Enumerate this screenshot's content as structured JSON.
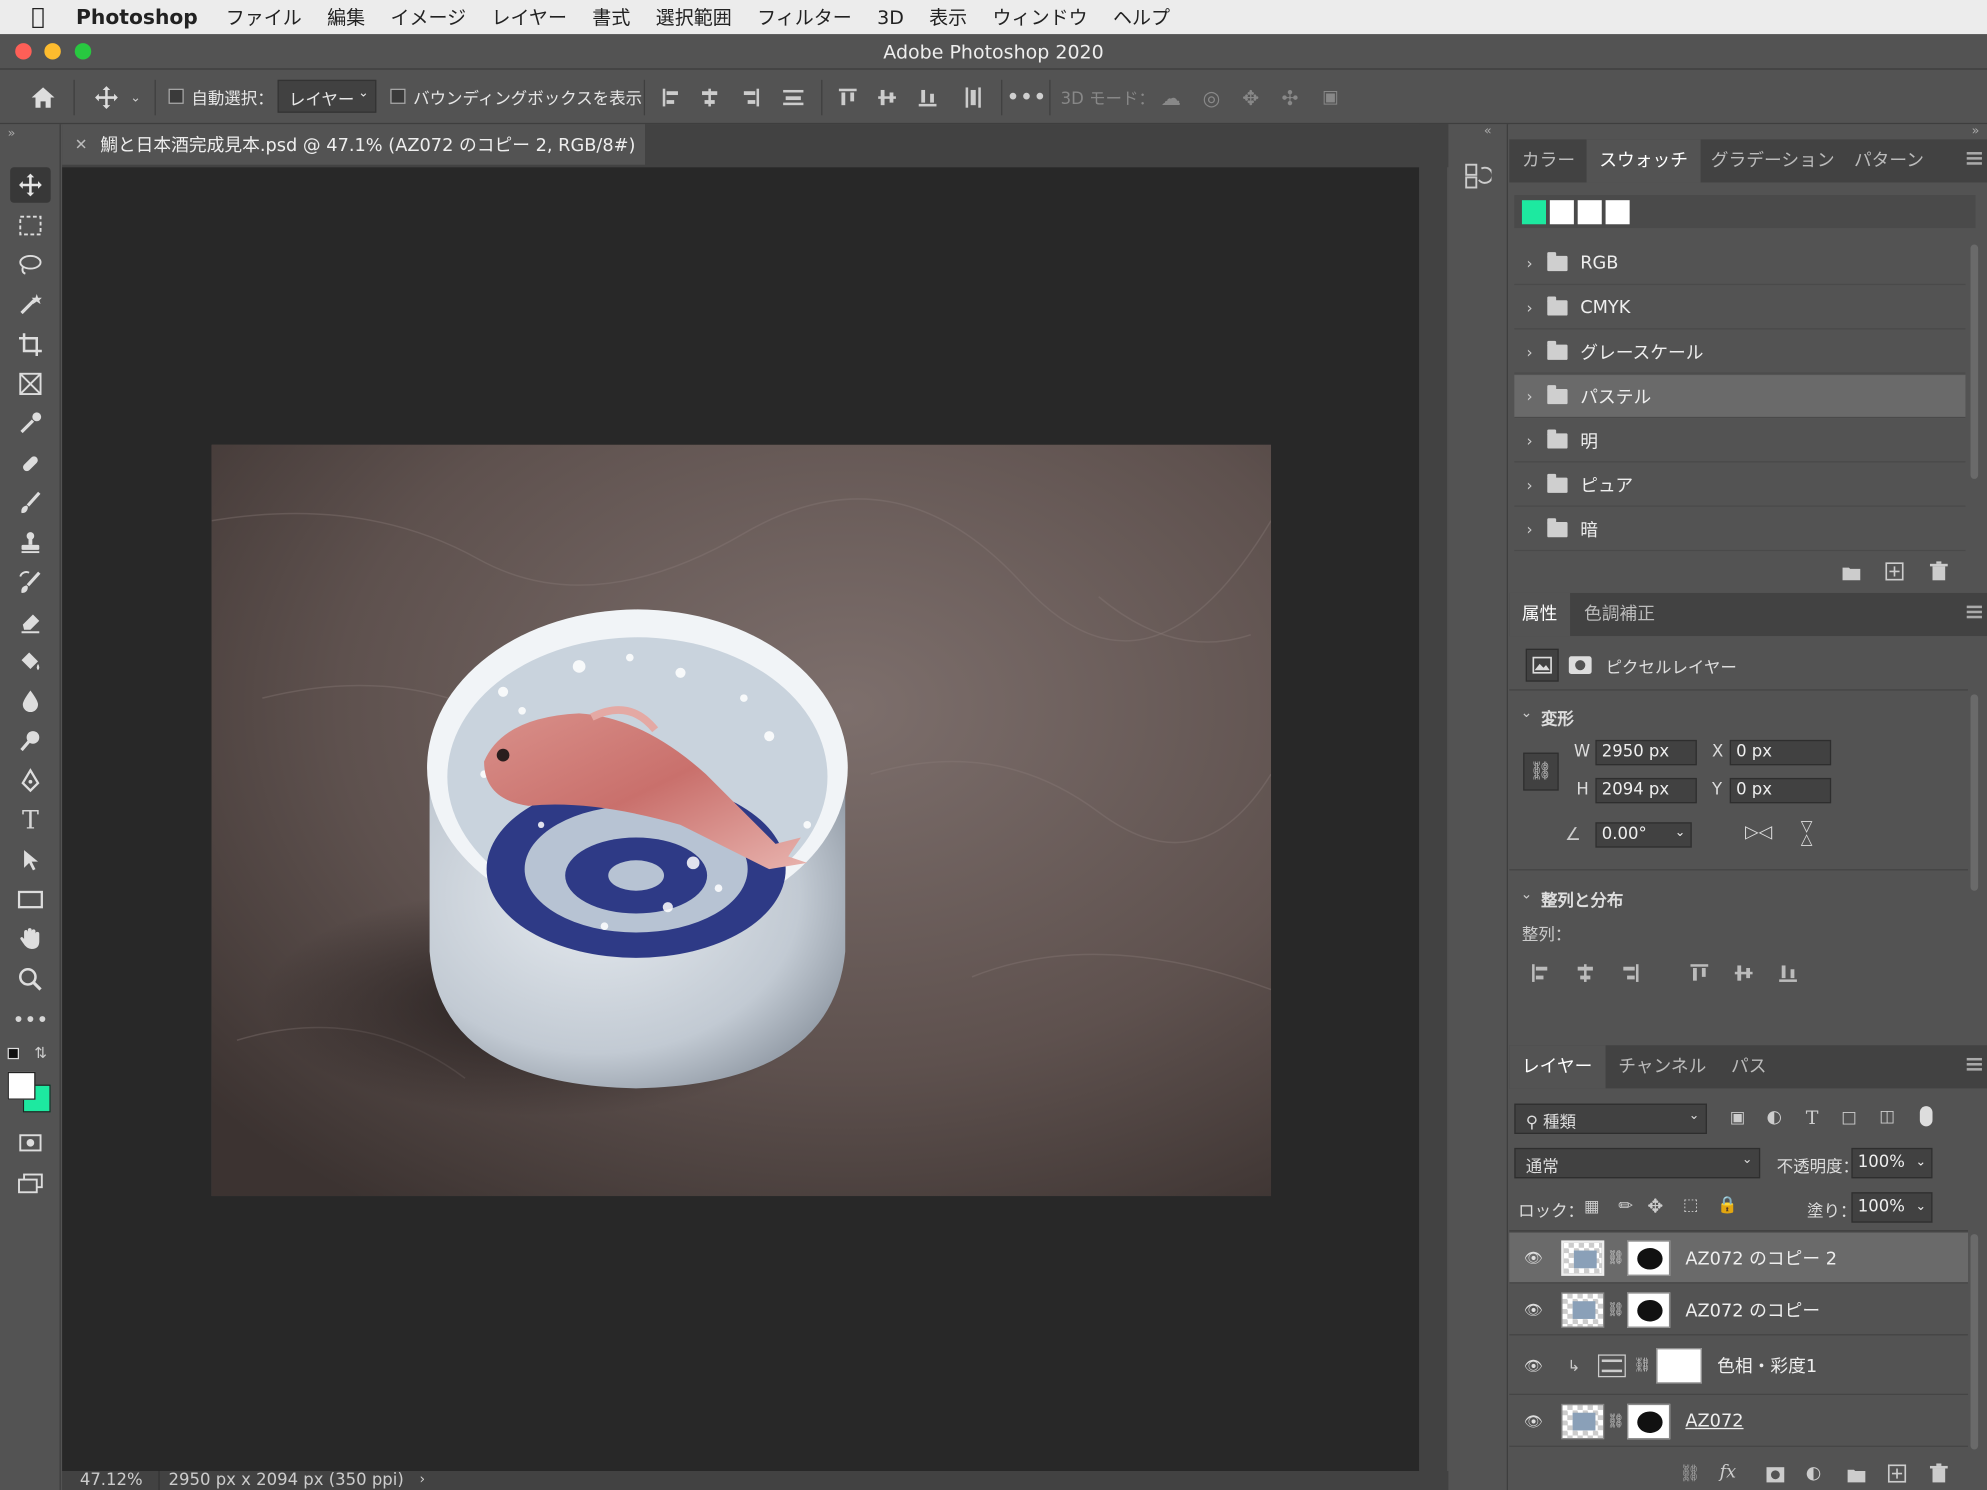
{
  "menubar": {
    "app_name": "Photoshop",
    "items": [
      "ファイル",
      "編集",
      "イメージ",
      "レイヤー",
      "書式",
      "選択範囲",
      "フィルター",
      "3D",
      "表示",
      "ウィンドウ",
      "ヘルプ"
    ]
  },
  "window": {
    "title": "Adobe Photoshop 2020"
  },
  "options": {
    "auto_select_label": "自動選択：",
    "auto_select_target": "レイヤー",
    "bounding_box_label": "バウンディングボックスを表示",
    "mode_3d_label": "3D モード："
  },
  "document": {
    "tab_title": "鯛と日本酒完成見本.psd @ 47.1% (AZ072 のコピー 2, RGB/8#)",
    "zoom_status": "47.12%",
    "size_status": "2950 px x 2094 px (350 ppi)"
  },
  "swatches_panel": {
    "tabs": [
      "カラー",
      "スウォッチ",
      "グラデーション",
      "パターン"
    ],
    "active_tab": "スウォッチ",
    "recent_colors": [
      "#1de9a0",
      "#ffffff",
      "#ffffff",
      "#ffffff"
    ],
    "folders": [
      "RGB",
      "CMYK",
      "グレースケール",
      "パステル",
      "明",
      "ピュア",
      "暗"
    ],
    "highlighted_folder": "パステル"
  },
  "properties_panel": {
    "tabs": [
      "属性",
      "色調補正"
    ],
    "layer_kind": "ピクセルレイヤー",
    "transform_header": "変形",
    "w_label": "W",
    "w_value": "2950 px",
    "h_label": "H",
    "h_value": "2094 px",
    "x_label": "X",
    "x_value": "0 px",
    "y_label": "Y",
    "y_value": "0 px",
    "angle_value": "0.00°",
    "align_header": "整列と分布",
    "align_label": "整列："
  },
  "layers_panel": {
    "tabs": [
      "レイヤー",
      "チャンネル",
      "パス"
    ],
    "filter_label": "種類",
    "blend_mode": "通常",
    "opacity_label": "不透明度：",
    "opacity_value": "100%",
    "lock_label": "ロック：",
    "fill_label": "塗り：",
    "fill_value": "100%",
    "layers": [
      {
        "name": "AZ072 のコピー 2",
        "selected": true
      },
      {
        "name": "AZ072 のコピー",
        "selected": false
      },
      {
        "name": "色相・彩度1",
        "selected": false
      },
      {
        "name": "AZ072",
        "selected": false
      }
    ]
  },
  "colors": {
    "foreground": "#ffffff",
    "background": "#1de9a0"
  }
}
